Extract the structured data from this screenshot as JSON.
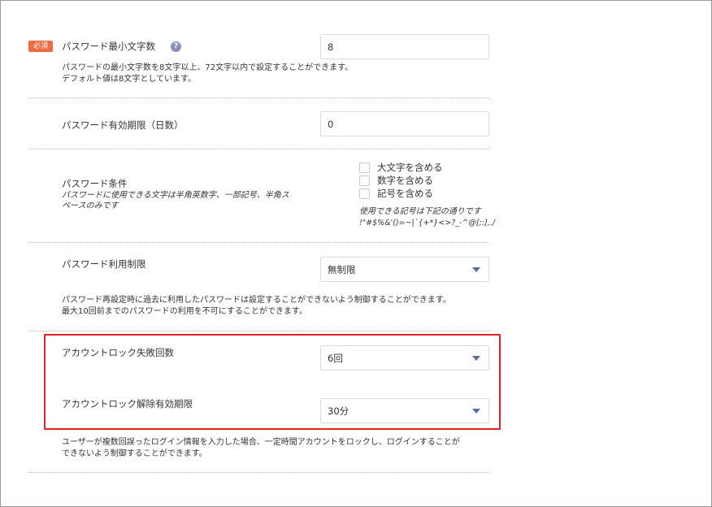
{
  "min_length": {
    "badge": "必須",
    "label": "パスワード最小文字数",
    "help_icon": "?",
    "value": "8",
    "desc_line1": "パスワードの最小文字数を8文字以上、72文字以内で設定することができます。",
    "desc_line2": "デフォルト値は8文字としています。"
  },
  "expiry": {
    "label": "パスワード有効期限（日数）",
    "value": "0"
  },
  "conditions": {
    "label": "パスワード条件",
    "note_line1": "パスワードに使用できる文字は半角英数字、一部記号、半角ス",
    "note_line2": "ペースのみです",
    "options": [
      {
        "label": "大文字を含める"
      },
      {
        "label": "数字を含める"
      },
      {
        "label": "記号を含める"
      }
    ],
    "symbols_note": "使用できる記号は下記の通りです",
    "symbols": "!\"#$%&'()=~|`{+*}<>?_-^@[;:],./"
  },
  "reuse": {
    "label": "パスワード利用制限",
    "selected": "無制限",
    "desc_line1": "パスワード再設定時に過去に利用したパスワードは設定することができないよう制御することができます。",
    "desc_line2": "最大10回前までのパスワードの利用を不可にすることができます。"
  },
  "lock_count": {
    "label": "アカウントロック失敗回数",
    "selected": "6回"
  },
  "lock_duration": {
    "label": "アカウントロック解除有効期限",
    "selected": "30分"
  },
  "lock_desc": {
    "line1": "ユーザーが複数回誤ったログイン情報を入力した場合、一定時間アカウントをロックし、ログインすることが",
    "line2": "できないよう制御することができます。"
  },
  "colors": {
    "required_badge": "#f06b3f",
    "highlight_border": "#e02424",
    "caret": "#5d6aa0"
  }
}
